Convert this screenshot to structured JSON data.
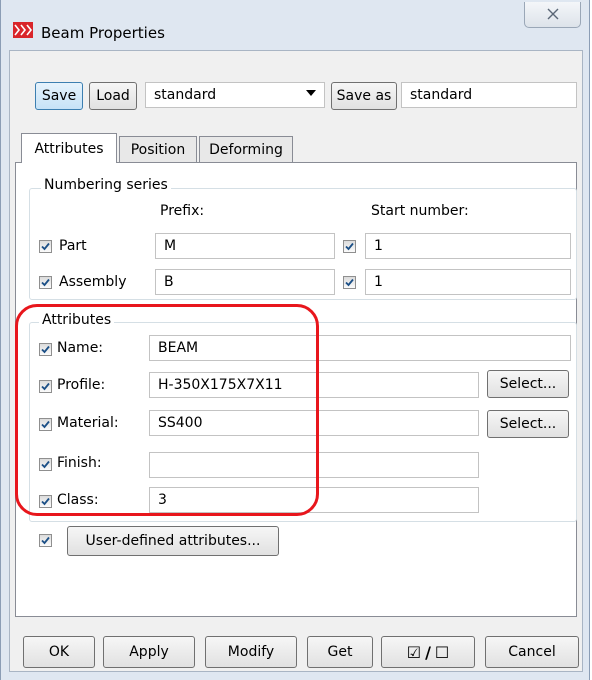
{
  "window": {
    "title": "Beam Properties"
  },
  "toolbar": {
    "save_label": "Save",
    "load_label": "Load",
    "preset_value": "standard",
    "save_as_label": "Save as",
    "save_as_value": "standard"
  },
  "tabs": [
    {
      "label": "Attributes",
      "selected": true
    },
    {
      "label": "Position",
      "selected": false
    },
    {
      "label": "Deforming",
      "selected": false
    }
  ],
  "numbering": {
    "legend": "Numbering series",
    "prefix_header": "Prefix:",
    "start_header": "Start number:",
    "rows": [
      {
        "label": "Part",
        "checked": true,
        "prefix": "M",
        "start_checked": true,
        "start": "1"
      },
      {
        "label": "Assembly",
        "checked": true,
        "prefix": "B",
        "start_checked": true,
        "start": "1"
      }
    ]
  },
  "attributes": {
    "legend": "Attributes",
    "rows": [
      {
        "label": "Name:",
        "checked": true,
        "value": "BEAM"
      },
      {
        "label": "Profile:",
        "checked": true,
        "value": "H-350X175X7X11",
        "select_label": "Select..."
      },
      {
        "label": "Material:",
        "checked": true,
        "value": "SS400",
        "select_label": "Select..."
      },
      {
        "label": "Finish:",
        "checked": true,
        "value": ""
      },
      {
        "label": "Class:",
        "checked": true,
        "value": "3"
      }
    ]
  },
  "user_defined": {
    "checked": true,
    "label": "User-defined attributes..."
  },
  "footer": {
    "ok": "OK",
    "apply": "Apply",
    "modify": "Modify",
    "get": "Get",
    "toggle_on": "☑",
    "toggle_sep": "/",
    "toggle_off": "☐",
    "cancel": "Cancel"
  },
  "colors": {
    "highlight_outline": "#e8161c",
    "active_button": "#c6e2f7"
  }
}
